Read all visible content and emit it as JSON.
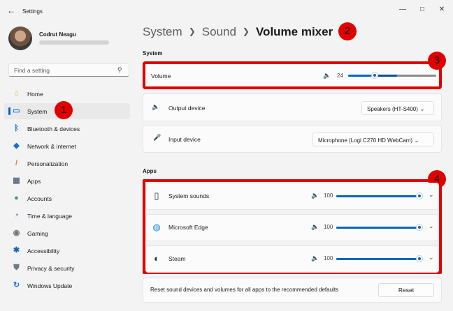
{
  "window": {
    "title": "Settings",
    "back_icon": "arrow-left-icon"
  },
  "user": {
    "name": "Codrut Neagu"
  },
  "search": {
    "placeholder": "Find a setting"
  },
  "sidebar": {
    "items": [
      {
        "label": "Home",
        "icon": "home-icon",
        "color": "#d9a441"
      },
      {
        "label": "System",
        "icon": "system-icon",
        "color": "#1e88e5",
        "selected": true
      },
      {
        "label": "Bluetooth & devices",
        "icon": "bluetooth-icon",
        "color": "#0a74da"
      },
      {
        "label": "Network & internet",
        "icon": "wifi-icon",
        "color": "#1470c9"
      },
      {
        "label": "Personalization",
        "icon": "brush-icon",
        "color": "#e07b39"
      },
      {
        "label": "Apps",
        "icon": "apps-icon",
        "color": "#5a6b80"
      },
      {
        "label": "Accounts",
        "icon": "accounts-icon",
        "color": "#2ea86b"
      },
      {
        "label": "Time & language",
        "icon": "globe-clock-icon",
        "color": "#1c7ed6"
      },
      {
        "label": "Gaming",
        "icon": "gamepad-icon",
        "color": "#777777"
      },
      {
        "label": "Accessibility",
        "icon": "accessibility-icon",
        "color": "#1565c0"
      },
      {
        "label": "Privacy & security",
        "icon": "shield-icon",
        "color": "#6d7a88"
      },
      {
        "label": "Windows Update",
        "icon": "update-icon",
        "color": "#1976d2"
      }
    ]
  },
  "breadcrumb": {
    "part1": "System",
    "part2": "Sound",
    "current": "Volume mixer"
  },
  "system_section": {
    "heading": "System",
    "volume": {
      "label": "Volume",
      "value": "24",
      "level": 0.24
    },
    "output": {
      "label": "Output device",
      "selected": "Speakers (HT-S400)"
    },
    "input": {
      "label": "Input device",
      "selected": "Microphone (Logi C270 HD WebCam)"
    }
  },
  "apps_section": {
    "heading": "Apps",
    "apps": [
      {
        "name": "System sounds",
        "volume": "100",
        "level": 1.0,
        "icon": "speaker-box-icon"
      },
      {
        "name": "Microsoft Edge",
        "volume": "100",
        "level": 1.0,
        "icon": "edge-icon"
      },
      {
        "name": "Steam",
        "volume": "100",
        "level": 1.0,
        "icon": "steam-icon"
      }
    ]
  },
  "reset": {
    "text": "Reset sound devices and volumes for all apps to the recommended defaults",
    "button": "Reset"
  },
  "annotations": {
    "b1": "1",
    "b2": "2",
    "b3": "3",
    "b4": "4"
  },
  "colors": {
    "accent": "#0067c0",
    "annotation_red": "#e00000"
  }
}
